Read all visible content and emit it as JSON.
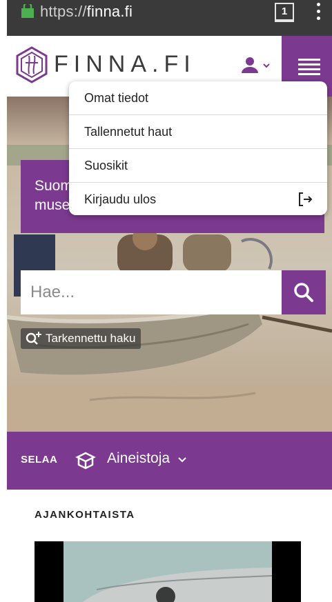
{
  "browser": {
    "url_prefix": "https://",
    "url_domain": "finna.fi",
    "tab_count": "1"
  },
  "header": {
    "logo_text": "FINNA.FI"
  },
  "user_menu": {
    "items": [
      {
        "label": "Omat tiedot"
      },
      {
        "label": "Tallennetut haut"
      },
      {
        "label": "Suosikit"
      },
      {
        "label": "Kirjaudu ulos"
      }
    ]
  },
  "hero": {
    "promo_line1": "Suom",
    "promo_line2": "muse",
    "search_placeholder": "Hae...",
    "advanced_search_label": "Tarkennettu haku"
  },
  "browse": {
    "label": "SELAA",
    "selected": "Aineistoja"
  },
  "news": {
    "heading": "AJANKOHTAISTA"
  },
  "colors": {
    "brand_purple": "#7b3a8f",
    "browser_bar": "#3a3a3a",
    "lock_green": "#4caf50"
  }
}
